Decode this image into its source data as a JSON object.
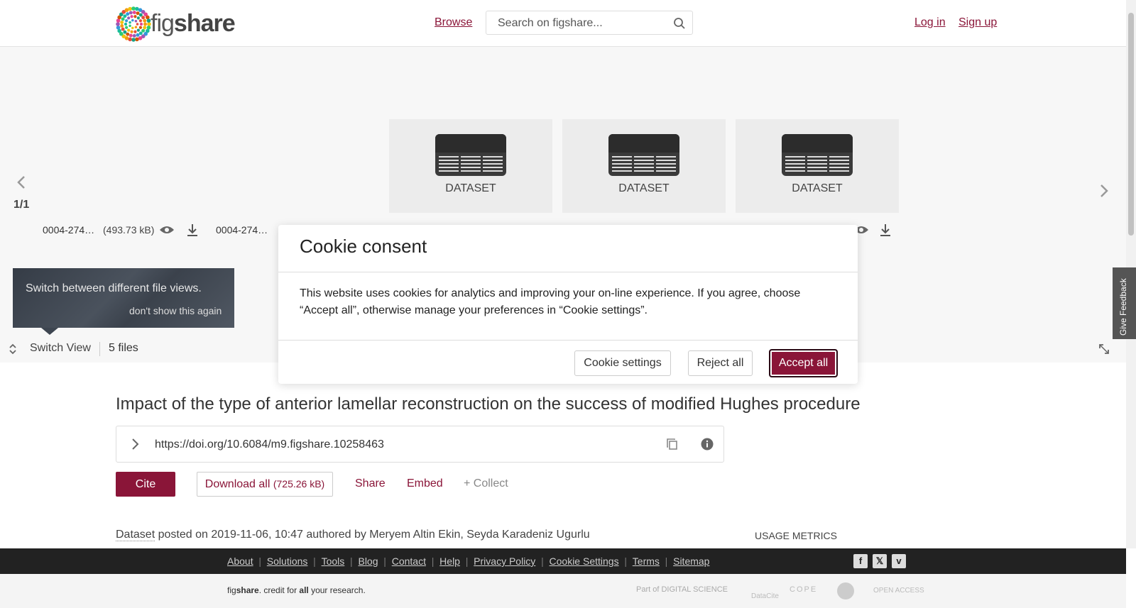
{
  "header": {
    "logo_text_light": "fig",
    "logo_text_bold": "share",
    "browse_label": "Browse",
    "search_placeholder": "Search on figshare...",
    "login_label": "Log in",
    "signup_label": "Sign up"
  },
  "viewer": {
    "page_indicator": "1/1",
    "tiles": [
      {
        "label": "DATASET"
      },
      {
        "label": "DATASET"
      },
      {
        "label": "DATASET"
      }
    ],
    "files": [
      {
        "name": "0004-274…",
        "size": "(493.73 kB)"
      },
      {
        "name": "0004-274…",
        "size": ""
      }
    ],
    "tooltip": {
      "text": "Switch between different file views.",
      "dismiss": "don't show this again"
    },
    "switch_view_label": "Switch View",
    "file_count": "5 files"
  },
  "cookie_modal": {
    "title": "Cookie consent",
    "body": "This website uses cookies for analytics and improving your on-line experience. If you agree, choose “Accept all”, otherwise manage your preferences in “Cookie settings”.",
    "settings_label": "Cookie settings",
    "reject_label": "Reject all",
    "accept_label": "Accept all"
  },
  "item": {
    "title": "Impact of the type of anterior lamellar reconstruction on the success of modified Hughes procedure",
    "doi": "https://doi.org/10.6084/m9.figshare.10258463",
    "cite_label": "Cite",
    "download_label": "Download all",
    "download_size": "(725.26 kB)",
    "share_label": "Share",
    "embed_label": "Embed",
    "collect_label": "+ Collect",
    "type_label": "Dataset",
    "posted_text": "posted on 2019-11-06, 10:47 authored by Meryem Altin Ekin, Seyda Karadeniz Ugurlu",
    "usage_metrics_label": "USAGE METRICS"
  },
  "footer": {
    "links": [
      "About",
      "Solutions",
      "Tools",
      "Blog",
      "Contact",
      "Help",
      "Privacy Policy",
      "Cookie Settings",
      "Terms",
      "Sitemap"
    ],
    "tagline_light": "fig",
    "tagline_bold": "share",
    "tagline_rest_1": ". credit for ",
    "tagline_all": "all",
    "tagline_rest_2": " your research.",
    "partners": [
      "Part of DIGITAL SCIENCE",
      "DataCite",
      "COPE",
      "",
      "OPEN ACCESS"
    ]
  },
  "feedback_label": "Give Feedback",
  "colors": {
    "brand": "#8a1538",
    "footer_bg": "#222222"
  }
}
